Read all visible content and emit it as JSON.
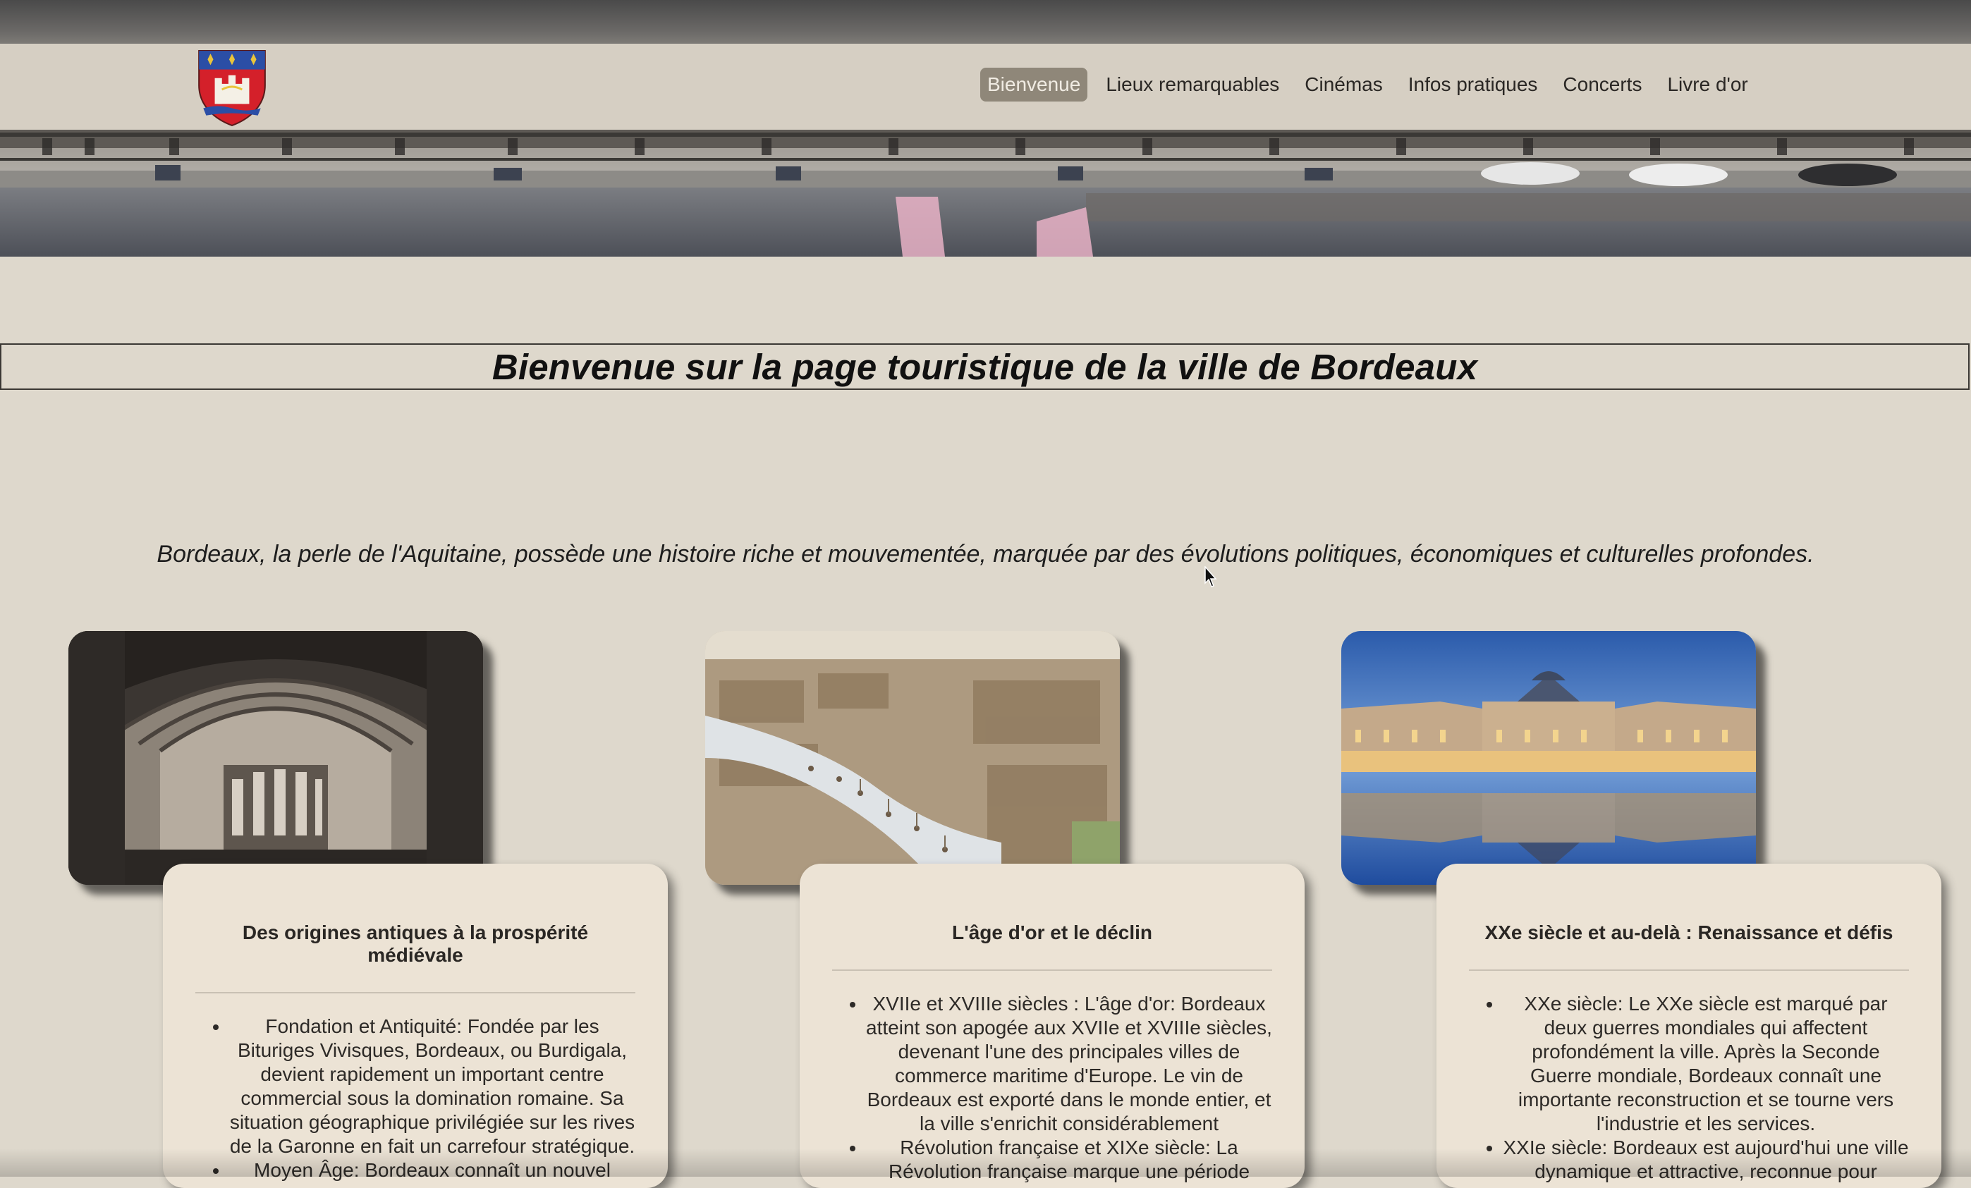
{
  "nav": {
    "items": [
      {
        "label": "Bienvenue",
        "active": true
      },
      {
        "label": "Lieux remarquables",
        "active": false
      },
      {
        "label": "Cinémas",
        "active": false
      },
      {
        "label": "Infos pratiques",
        "active": false
      },
      {
        "label": "Concerts",
        "active": false
      },
      {
        "label": "Livre d'or",
        "active": false
      }
    ]
  },
  "page": {
    "title": "Bienvenue sur la page touristique de la ville de Bordeaux",
    "intro": "Bordeaux, la perle de l'Aquitaine, possède une histoire riche et mouvementée, marquée par des évolutions politiques, économiques et culturelles profondes."
  },
  "cards": [
    {
      "heading": "Des origines antiques à la prospérité médiévale",
      "items": [
        "Fondation et Antiquité: Fondée par les Bituriges Vivisques, Bordeaux, ou Burdigala, devient rapidement un important centre commercial sous la domination romaine. Sa situation géographique privilégiée sur les rives de la Garonne en fait un carrefour stratégique.",
        "Moyen Âge: Bordeaux connaît un nouvel"
      ]
    },
    {
      "heading": "L'âge d'or et le déclin",
      "items": [
        "XVIIe et XVIIIe siècles : L'âge d'or: Bordeaux atteint son apogée aux XVIIe et XVIIIe siècles, devenant l'une des principales villes de commerce maritime d'Europe. Le vin de Bordeaux est exporté dans le monde entier, et la ville s'enrichit considérablement",
        "Révolution française et XIXe siècle: La Révolution française marque une période"
      ]
    },
    {
      "heading": "XXe siècle et au-delà : Renaissance et défis",
      "items": [
        "XXe siècle: Le XXe siècle est marqué par deux guerres mondiales qui affectent profondément la ville. Après la Seconde Guerre mondiale, Bordeaux connaît une importante reconstruction et se tourne vers l'industrie et les services.",
        "XXIe siècle: Bordeaux est aujourd'hui une ville dynamique et attractive, reconnue pour"
      ]
    }
  ],
  "colors": {
    "background": "#ded8cc",
    "header": "#d6cfc3",
    "nav_active": "#8f8779",
    "card": "#ece3d5"
  }
}
